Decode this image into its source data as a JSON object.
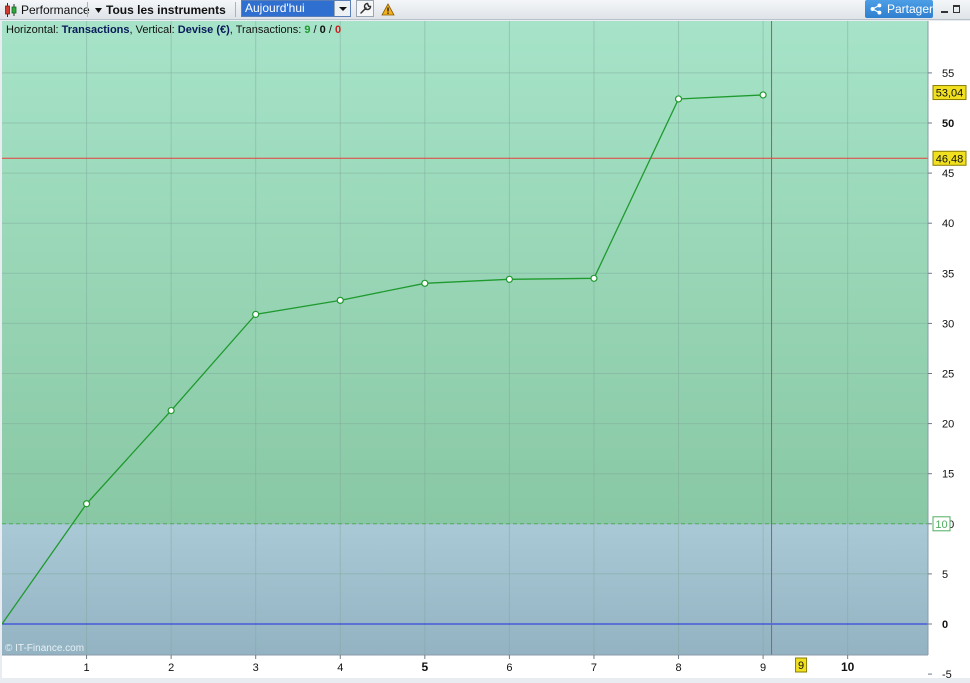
{
  "toolbar": {
    "performance_label": "Performance",
    "instruments_label": "Tous les instruments",
    "period_value": "Aujourd'hui",
    "share_label": "Partager",
    "icons": [
      "candlestick-icon",
      "chevron-down-icon",
      "wrench-icon",
      "warning-icon",
      "share-icon"
    ]
  },
  "info": {
    "horizontal_label": "Horizontal: ",
    "horizontal_value": "Transactions",
    "vertical_label": ", Vertical: ",
    "vertical_value": "Devise (€)",
    "transactions_label": ", Transactions: ",
    "count_total": "9",
    "sep1": " / ",
    "count_neutral": "0",
    "sep2": " / ",
    "count_loss": "0"
  },
  "watermark": "© IT-Finance.com",
  "colors": {
    "upper_zone_top": "#a6e3c8",
    "upper_zone_bottom": "#89c8a4",
    "lower_zone_top": "#a9c9d6",
    "lower_zone_bottom": "#93b3c3",
    "line": "#1f9a2e",
    "zero_line": "#1b2be0",
    "crosshair": "#e6403a",
    "threshold_line": "#4fae5f",
    "label_bg": "#f0e020",
    "bold_blue": "#0f1a8a",
    "total_color": "#1f9a2e",
    "loss_color": "#cc1f1f"
  },
  "chart_data": {
    "type": "line",
    "x": [
      0,
      1,
      2,
      3,
      4,
      5,
      6,
      7,
      8,
      9
    ],
    "y": [
      0,
      12.0,
      21.3,
      30.9,
      32.3,
      34.0,
      34.4,
      34.5,
      52.4,
      52.8
    ],
    "xlim": [
      0,
      10.95
    ],
    "ylim": [
      -5,
      58
    ],
    "x_ticks": [
      {
        "v": 1,
        "label": "1",
        "bold": false
      },
      {
        "v": 2,
        "label": "2",
        "bold": false
      },
      {
        "v": 3,
        "label": "3",
        "bold": false
      },
      {
        "v": 4,
        "label": "4",
        "bold": false
      },
      {
        "v": 5,
        "label": "5",
        "bold": true
      },
      {
        "v": 6,
        "label": "6",
        "bold": false
      },
      {
        "v": 7,
        "label": "7",
        "bold": false
      },
      {
        "v": 8,
        "label": "8",
        "bold": false
      },
      {
        "v": 9,
        "label": "9",
        "bold": false
      },
      {
        "v": 10,
        "label": "10",
        "bold": true
      }
    ],
    "y_ticks": [
      {
        "v": 55,
        "label": "55",
        "bold": false
      },
      {
        "v": 50,
        "label": "50",
        "bold": true
      },
      {
        "v": 45,
        "label": "45",
        "bold": false
      },
      {
        "v": 40,
        "label": "40",
        "bold": false
      },
      {
        "v": 35,
        "label": "35",
        "bold": false
      },
      {
        "v": 30,
        "label": "30",
        "bold": false
      },
      {
        "v": 25,
        "label": "25",
        "bold": false
      },
      {
        "v": 20,
        "label": "20",
        "bold": false
      },
      {
        "v": 15,
        "label": "15",
        "bold": false
      },
      {
        "v": 10,
        "label": "10",
        "bold": false
      },
      {
        "v": 5,
        "label": "5",
        "bold": false
      },
      {
        "v": 0,
        "label": "0",
        "bold": true
      },
      {
        "v": -5,
        "label": "-5",
        "bold": false
      }
    ],
    "threshold": {
      "v": 10,
      "label": "10"
    },
    "last_value": {
      "v": 53.04,
      "label": "53,04"
    },
    "crosshair": {
      "x": 9.1,
      "x_label": "9",
      "y": 46.48,
      "y_label": "46,48"
    },
    "grid": true
  }
}
